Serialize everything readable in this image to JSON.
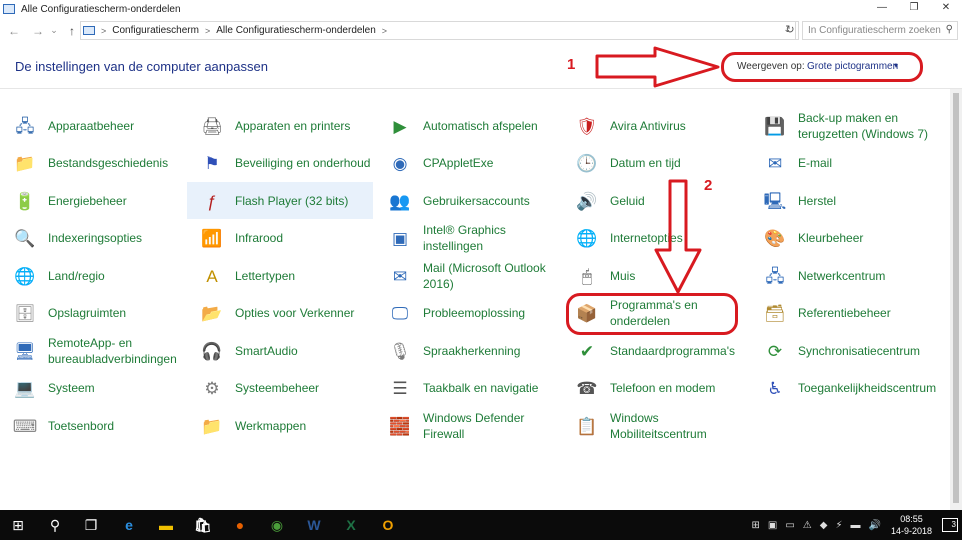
{
  "window": {
    "title": "Alle Configuratiescherm-onderdelen",
    "minimize": "—",
    "maximize": "❐",
    "close": "✕"
  },
  "address": {
    "back": "←",
    "forward": "→",
    "recent": "⌄",
    "up": "↑",
    "crumbs": [
      "Configuratiescherm",
      "Alle Configuratiescherm-onderdelen"
    ],
    "separator": ">",
    "dropdown": "⌄",
    "refresh": "↻",
    "search_placeholder": "In Configuratiescherm zoeken"
  },
  "header": {
    "title": "De instellingen van de computer aanpassen",
    "view_by_label": "Weergeven op:",
    "view_by_value": "Grote pictogrammen",
    "view_by_arrow": "▾"
  },
  "annotations": {
    "label_1": "1",
    "label_2": "2",
    "color": "#d81a20"
  },
  "items": [
    [
      {
        "label": "Apparaatbeheer",
        "icon": "device-manager-icon",
        "glyph": "🖧",
        "color": "#3a6fb0"
      },
      {
        "label": "Bestandsgeschiedenis",
        "icon": "file-history-icon",
        "glyph": "📁",
        "color": "#d9a400"
      },
      {
        "label": "Energiebeheer",
        "icon": "power-options-icon",
        "glyph": "🔋",
        "color": "#2f8f3a"
      },
      {
        "label": "Indexeringsopties",
        "icon": "indexing-icon",
        "glyph": "🔍",
        "color": "#7a7a7a"
      },
      {
        "label": "Land/regio",
        "icon": "region-globe-icon",
        "glyph": "🌐",
        "color": "#2f6ab8"
      },
      {
        "label": "Opslagruimten",
        "icon": "storage-spaces-icon",
        "glyph": "🗄",
        "color": "#7a7a7a"
      },
      {
        "label": "RemoteApp- en bureaubladverbindingen",
        "icon": "remote-desktop-icon",
        "glyph": "🖥",
        "color": "#2f6ab8"
      },
      {
        "label": "Systeem",
        "icon": "system-icon",
        "glyph": "💻",
        "color": "#2f6ab8"
      },
      {
        "label": "Toetsenbord",
        "icon": "keyboard-icon",
        "glyph": "⌨",
        "color": "#8a8a8a"
      }
    ],
    [
      {
        "label": "Apparaten en printers",
        "icon": "devices-printers-icon",
        "glyph": "🖨",
        "color": "#555"
      },
      {
        "label": "Beveiliging en onderhoud",
        "icon": "security-flag-icon",
        "glyph": "⚑",
        "color": "#2f50b8"
      },
      {
        "label": "Flash Player (32 bits)",
        "icon": "flash-player-icon",
        "glyph": "ƒ",
        "color": "#b41e1e"
      },
      {
        "label": "Infrarood",
        "icon": "infrared-icon",
        "glyph": "📶",
        "color": "#7a7a7a"
      },
      {
        "label": "Lettertypen",
        "icon": "fonts-icon",
        "glyph": "A",
        "color": "#c09000"
      },
      {
        "label": "Opties voor Verkenner",
        "icon": "folder-options-icon",
        "glyph": "📂",
        "color": "#d9a400"
      },
      {
        "label": "SmartAudio",
        "icon": "smartaudio-icon",
        "glyph": "🎧",
        "color": "#222"
      },
      {
        "label": "Systeembeheer",
        "icon": "admin-tools-icon",
        "glyph": "⚙",
        "color": "#7a7a7a"
      },
      {
        "label": "Werkmappen",
        "icon": "work-folders-icon",
        "glyph": "📁",
        "color": "#d9a400"
      }
    ],
    [
      {
        "label": "Automatisch afspelen",
        "icon": "autoplay-icon",
        "glyph": "▶",
        "color": "#2f8f3a"
      },
      {
        "label": "CPAppletExe",
        "icon": "cpapplet-wifi-icon",
        "glyph": "◉",
        "color": "#2f6ab8"
      },
      {
        "label": "Gebruikersaccounts",
        "icon": "user-accounts-icon",
        "glyph": "👥",
        "color": "#3a6fb0"
      },
      {
        "label": "Intel® Graphics instellingen",
        "icon": "intel-graphics-icon",
        "glyph": "▣",
        "color": "#2f6ab8"
      },
      {
        "label": "Mail (Microsoft Outlook 2016)",
        "icon": "mail-icon",
        "glyph": "✉",
        "color": "#2f6ab8"
      },
      {
        "label": "Probleemoplossing",
        "icon": "troubleshooting-icon",
        "glyph": "🖵",
        "color": "#2f6ab8"
      },
      {
        "label": "Spraakherkenning",
        "icon": "microphone-icon",
        "glyph": "🎙",
        "color": "#7a7a7a"
      },
      {
        "label": "Taakbalk en navigatie",
        "icon": "taskbar-icon",
        "glyph": "☰",
        "color": "#555"
      },
      {
        "label": "Windows Defender Firewall",
        "icon": "firewall-icon",
        "glyph": "🧱",
        "color": "#a0522d"
      }
    ],
    [
      {
        "label": "Avira Antivirus",
        "icon": "avira-shield-icon",
        "glyph": "🛡",
        "color": "#c81e1e"
      },
      {
        "label": "Datum en tijd",
        "icon": "date-time-icon",
        "glyph": "🕒",
        "color": "#2f6ab8"
      },
      {
        "label": "Geluid",
        "icon": "sound-speaker-icon",
        "glyph": "🔊",
        "color": "#7a7a7a"
      },
      {
        "label": "Internetopties",
        "icon": "internet-options-icon",
        "glyph": "🌐",
        "color": "#2f6ab8"
      },
      {
        "label": "Muis",
        "icon": "mouse-icon",
        "glyph": "🖱",
        "color": "#555"
      },
      {
        "label": "Programma's en onderdelen",
        "icon": "programs-features-icon",
        "glyph": "📦",
        "color": "#7a7a7a"
      },
      {
        "label": "Standaardprogramma's",
        "icon": "default-programs-icon",
        "glyph": "✔",
        "color": "#2f8f3a"
      },
      {
        "label": "Telefoon en modem",
        "icon": "phone-modem-icon",
        "glyph": "☎",
        "color": "#555"
      },
      {
        "label": "Windows Mobiliteitscentrum",
        "icon": "mobility-center-icon",
        "glyph": "📋",
        "color": "#2f6ab8"
      }
    ],
    [
      {
        "label": "Back-up maken en terugzetten (Windows 7)",
        "icon": "backup-restore-icon",
        "glyph": "💾",
        "color": "#2f8f3a"
      },
      {
        "label": "E-mail",
        "icon": "email-icon",
        "glyph": "✉",
        "color": "#2f6ab8"
      },
      {
        "label": "Herstel",
        "icon": "recovery-icon",
        "glyph": "🖳",
        "color": "#2f6ab8"
      },
      {
        "label": "Kleurbeheer",
        "icon": "color-management-icon",
        "glyph": "🎨",
        "color": "#2f8f3a"
      },
      {
        "label": "Netwerkcentrum",
        "icon": "network-center-icon",
        "glyph": "🖧",
        "color": "#2f6ab8"
      },
      {
        "label": "Referentiebeheer",
        "icon": "credential-manager-icon",
        "glyph": "🗃",
        "color": "#b08a30"
      },
      {
        "label": "Synchronisatiecentrum",
        "icon": "sync-center-icon",
        "glyph": "⟳",
        "color": "#2f8f3a"
      },
      {
        "label": "Toegankelijkheidscentrum",
        "icon": "ease-of-access-icon",
        "glyph": "♿",
        "color": "#2f50b8"
      }
    ]
  ],
  "taskbar": {
    "start": "⊞",
    "search": "⚲",
    "taskview": "❐",
    "apps": [
      {
        "name": "edge",
        "glyph": "e",
        "color": "#2b8fe0"
      },
      {
        "name": "explorer",
        "glyph": "▬",
        "color": "#f0c000"
      },
      {
        "name": "store",
        "glyph": "🛍",
        "color": "#ffffff"
      },
      {
        "name": "firefox",
        "glyph": "●",
        "color": "#e66000"
      },
      {
        "name": "chrome",
        "glyph": "◉",
        "color": "#4a9d3a"
      },
      {
        "name": "word",
        "glyph": "W",
        "color": "#2b5797"
      },
      {
        "name": "excel",
        "glyph": "X",
        "color": "#1e7145"
      },
      {
        "name": "outlook",
        "glyph": "O",
        "color": "#f0a000"
      }
    ],
    "tray_icons": [
      "⊞",
      "▣",
      "▭",
      "⚠",
      "◆",
      "⚡",
      "▬",
      "🔊"
    ],
    "time": "08:55",
    "date": "14-9-2018",
    "notifications": "3"
  }
}
